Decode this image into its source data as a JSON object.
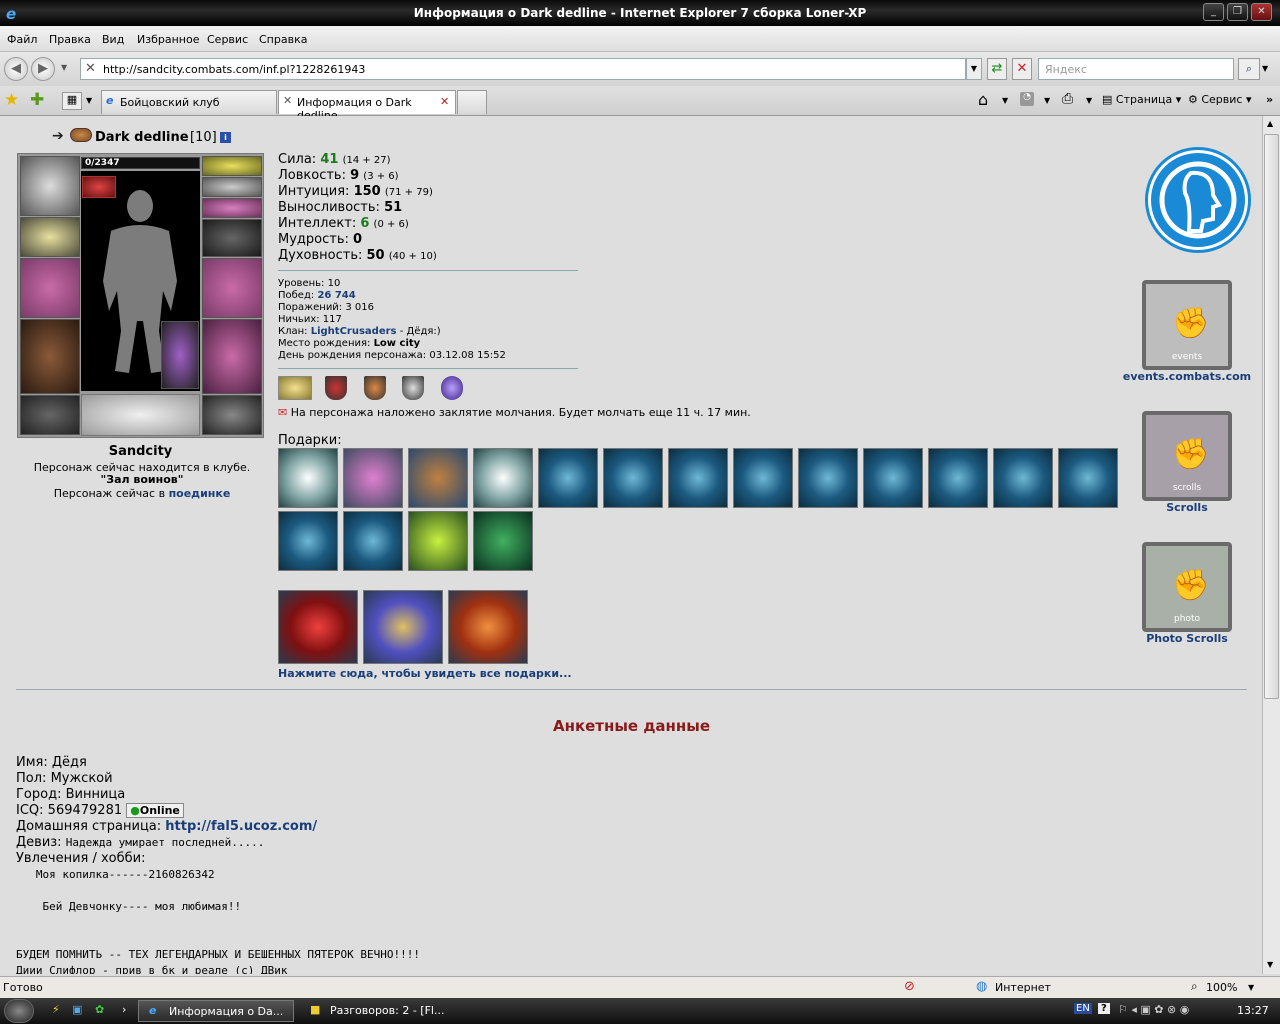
{
  "window": {
    "title": "Информация о Dark dedline - Internet Explorer 7 сборка Loner-XP"
  },
  "menu": [
    "Файл",
    "Правка",
    "Вид",
    "Избранное",
    "Сервис",
    "Справка"
  ],
  "address": {
    "url": "http://sandcity.combats.com/inf.pl?1228261943",
    "search_placeholder": "Яндекс"
  },
  "tabs": [
    {
      "label": "Бойцовский клуб"
    },
    {
      "label": "Информация о Dark dedline"
    }
  ],
  "toolbar": {
    "page_label": "Страница",
    "tools_label": "Сервис"
  },
  "character": {
    "name": "Dark dedline",
    "level": "[10]",
    "hp": "0/2347",
    "city": "Sandcity",
    "status1": "Персонаж сейчас находится в клубе.",
    "location": "\"Зал воинов\"",
    "status2_prefix": "Персонаж сейчас в",
    "status2_link": "поединке"
  },
  "stats": [
    {
      "label": "Сила:",
      "value": "41",
      "extra": "(14 + 27)",
      "color": "green"
    },
    {
      "label": "Ловкость:",
      "value": "9",
      "extra": "(3 + 6)",
      "color": "black"
    },
    {
      "label": "Интуиция:",
      "value": "150",
      "extra": "(71 + 79)",
      "color": "black"
    },
    {
      "label": "Выносливость:",
      "value": "51",
      "extra": "",
      "color": "black"
    },
    {
      "label": "Интеллект:",
      "value": "6",
      "extra": "(0 + 6)",
      "color": "green"
    },
    {
      "label": "Мудрость:",
      "value": "0",
      "extra": "",
      "color": "black"
    },
    {
      "label": "Духовность:",
      "value": "50",
      "extra": "(40 + 10)",
      "color": "black"
    }
  ],
  "info": {
    "level_label": "Уровень:",
    "level": "10",
    "wins_label": "Побед:",
    "wins": "26 744",
    "losses_label": "Поражений:",
    "losses": "3 016",
    "draws_label": "Ничьих:",
    "draws": "117",
    "clan_label": "Клан:",
    "clan": "LightCrusaders",
    "clan_suffix": "- Дёдя:)",
    "birthplace_label": "Место рождения:",
    "birthplace": "Low city",
    "birthday_label": "День рождения персонажа:",
    "birthday": "03.12.08 15:52"
  },
  "silence": "На персонажа наложено заклятие молчания. Будет молчать еще 11 ч. 17 мин.",
  "gifts": {
    "label": "Подарки:",
    "more_link": "Нажмите сюда, чтобы увидеть все подарки..."
  },
  "sidebar": {
    "events": "events.combats.com",
    "scrolls": "Scrolls",
    "photo": "Photo Scrolls",
    "banner_events": "events",
    "banner_scrolls": "scrolls",
    "banner_photo": "photo"
  },
  "profile": {
    "heading": "Анкетные данные",
    "name_label": "Имя:",
    "name": "Дёдя",
    "sex_label": "Пол:",
    "sex": "Мужской",
    "city_label": "Город:",
    "city": "Винница",
    "icq_label": "ICQ:",
    "icq": "569479281",
    "icq_status": "Online",
    "home_label": "Домашняя страница:",
    "home": "http://fal5.ucoz.com/",
    "motto_label": "Девиз:",
    "motto": "Надежда умирает последней.....",
    "hobby_label": "Увлечения / хобби:",
    "hobby_lines": [
      "   Моя копилка------2160826342",
      "",
      "    Бей Девчонку---- моя любимая!!",
      "",
      "",
      "БУДЕМ ПОМНИТЬ -- ТЕХ ЛЕГЕНДАРНЫХ И БЕШЕННЫХ ПЯТЕРОК ВЕЧНО!!!!",
      "Диии Слифлор - прив в бк и реале (c) ДВик"
    ]
  },
  "status": {
    "text": "Готово",
    "zone": "Интернет",
    "zoom": "100%"
  },
  "taskbar": {
    "task1": "Информация о Da...",
    "task2": "Разговоров: 2 - [Fl...",
    "lang": "EN",
    "time": "13:27"
  }
}
